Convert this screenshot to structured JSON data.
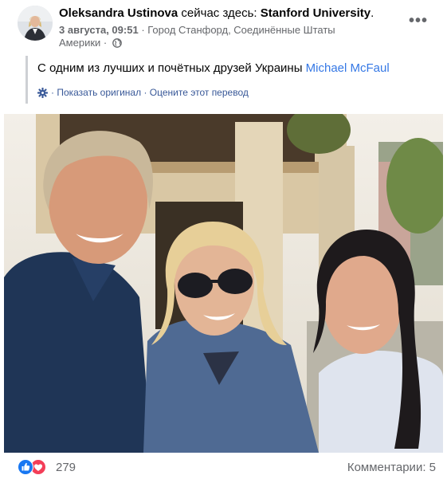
{
  "post": {
    "author": "Oleksandra Ustinova",
    "activity_text": "сейчас здесь:",
    "place": "Stanford University",
    "place_suffix": ".",
    "date": "3 августа, 09:51",
    "location": "· Город Станфорд, Соединённые Штаты Америки ·",
    "body_text": "С одним из лучших и почётных друзей Украины",
    "mention": "Michael McFaul",
    "translation": {
      "show_original": "· Показать оригинал",
      "separator": " · ",
      "rate": "Оцените этот перевод"
    },
    "more_icon": "more-options-icon",
    "privacy_icon": "globe-icon"
  },
  "footer": {
    "reaction_icons": [
      "like-icon",
      "love-icon"
    ],
    "reaction_count": "279",
    "comments": "Комментарии: 5"
  },
  "colors": {
    "link": "#3578e5",
    "translate_link": "#385898",
    "meta_text": "#65676b",
    "like": "#1877f2",
    "love": "#f33e58"
  }
}
